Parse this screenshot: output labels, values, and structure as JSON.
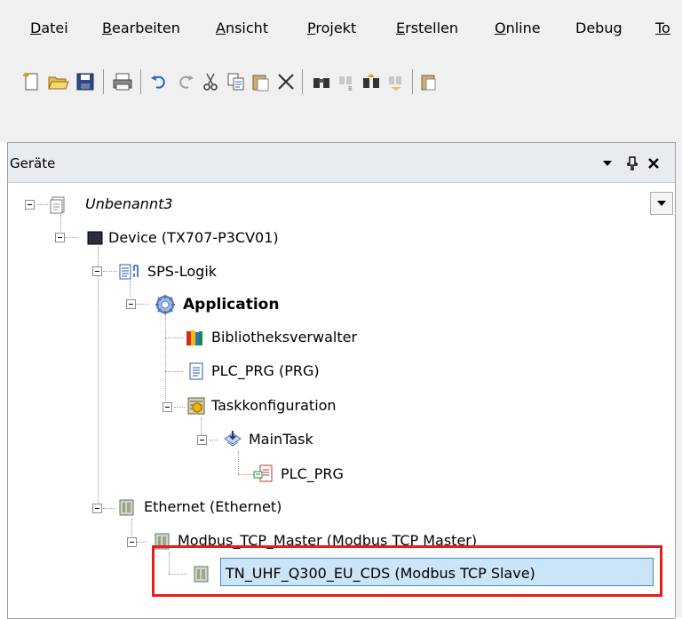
{
  "menu": {
    "items": [
      {
        "mn": "D",
        "rest": "atei"
      },
      {
        "mn": "B",
        "rest": "earbeiten"
      },
      {
        "mn": "A",
        "rest": "nsicht"
      },
      {
        "mn": "P",
        "rest": "rojekt"
      },
      {
        "mn": "E",
        "rest": "rstellen"
      },
      {
        "mn": "O",
        "rest": "nline"
      },
      {
        "pre": "Debu",
        "mn": "g",
        "rest": ""
      },
      {
        "mn": "To",
        "rest": ""
      }
    ]
  },
  "toolbar": {
    "icons": [
      "new-project-icon",
      "open-icon",
      "save-icon",
      "print-icon",
      "undo-icon",
      "redo-icon",
      "cut-icon",
      "copy-icon",
      "paste-icon",
      "delete-icon",
      "find-icon",
      "find-replace-icon",
      "find-next-icon",
      "find-previous-icon",
      "clipboard-icon"
    ]
  },
  "panel": {
    "title": "Geräte",
    "dropdown_icon": "triangle-down-icon",
    "pin_icon": "pin-icon",
    "close_icon": "close-icon"
  },
  "tree": {
    "nodes": [
      {
        "label": "Unbenannt3",
        "icon": "project-icon"
      },
      {
        "label": "Device (TX707-P3CV01)",
        "icon": "device-icon"
      },
      {
        "label": "SPS-Logik",
        "icon": "plc-logic-icon"
      },
      {
        "label": "Application",
        "icon": "application-gear-icon"
      },
      {
        "label": "Bibliotheksverwalter",
        "icon": "library-icon"
      },
      {
        "label": "PLC_PRG (PRG)",
        "icon": "program-icon"
      },
      {
        "label": "Taskkonfiguration",
        "icon": "task-config-icon"
      },
      {
        "label": "MainTask",
        "icon": "task-icon"
      },
      {
        "label": "PLC_PRG",
        "icon": "program-call-icon"
      },
      {
        "label": "Ethernet (Ethernet)",
        "icon": "ethernet-icon"
      },
      {
        "label": "Modbus_TCP_Master (Modbus TCP Master)",
        "icon": "modbus-master-icon"
      },
      {
        "label": "TN_UHF_Q300_EU_CDS (Modbus TCP Slave)",
        "icon": "modbus-slave-icon"
      }
    ]
  },
  "colors": {
    "selection": "#cce4f7",
    "highlight_border": "#e41e1e"
  }
}
